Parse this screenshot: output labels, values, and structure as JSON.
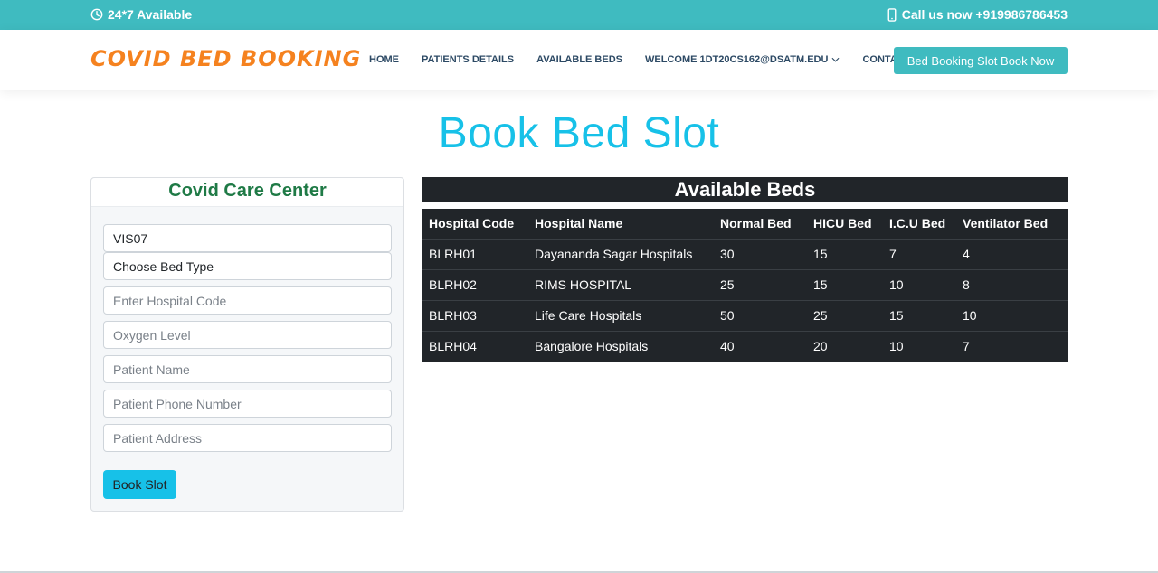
{
  "topbar": {
    "availability": "24*7 Available",
    "call": "Call us now +919986786453"
  },
  "brand": {
    "logo": "COVID BED BOOKING"
  },
  "nav": {
    "items": [
      "HOME",
      "PATIENTS DETAILS",
      "AVAILABLE BEDS"
    ],
    "welcome": "WELCOME 1DT20CS162@DSATM.EDU",
    "contact": "CONTACT",
    "cta": "Bed Booking Slot Book Now"
  },
  "page": {
    "title": "Book Bed Slot"
  },
  "form": {
    "title": "Covid Care Center",
    "center_select": "VIS07",
    "bed_type_select": "Choose Bed Type",
    "hospital_code_placeholder": "Enter Hospital Code",
    "oxygen_placeholder": "Oxygen Level",
    "patient_name_placeholder": "Patient Name",
    "patient_phone_placeholder": "Patient Phone Number",
    "patient_address_placeholder": "Patient Address",
    "submit_label": "Book Slot"
  },
  "beds": {
    "title": "Available Beds",
    "headers": [
      "Hospital Code",
      "Hospital Name",
      "Normal Bed",
      "HICU Bed",
      "I.C.U Bed",
      "Ventilator Bed"
    ],
    "rows": [
      [
        "BLRH01",
        "Dayananda Sagar Hospitals",
        "30",
        "15",
        "7",
        "4"
      ],
      [
        "BLRH02",
        "RIMS HOSPITAL",
        "25",
        "15",
        "10",
        "8"
      ],
      [
        "BLRH03",
        "Life Care Hospitals",
        "50",
        "25",
        "15",
        "10"
      ],
      [
        "BLRH04",
        "Bangalore Hospitals",
        "40",
        "20",
        "10",
        "7"
      ]
    ]
  },
  "colors": {
    "accent": "#3fbbc0",
    "logo": "#f5821f",
    "title": "#17c1e8",
    "card_title": "#1f7a46",
    "table_bg": "#212529"
  },
  "icons": {
    "availability": "clock-icon",
    "call": "phone-icon",
    "welcome": "chevron-down-icon"
  }
}
